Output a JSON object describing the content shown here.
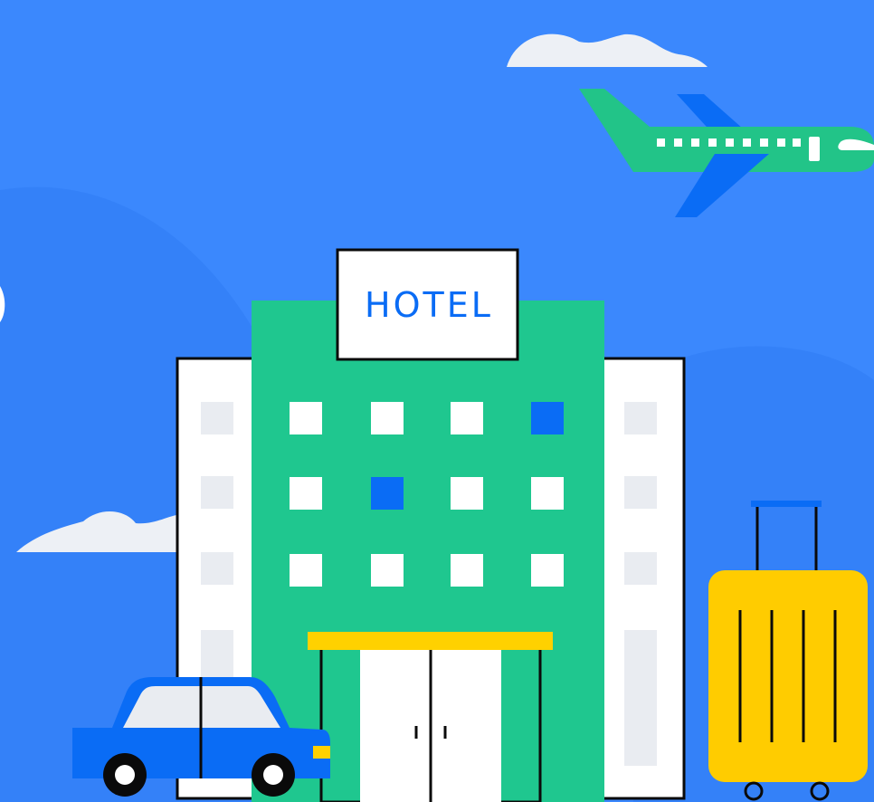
{
  "hotel_sign": {
    "text": "HOTEL"
  },
  "colors": {
    "sky": "#3b88fd",
    "sky_hill": "#3481f8",
    "cloud": "#edf0f5",
    "hotel_green": "#1fc78f",
    "hotel_side": "#ffffff",
    "window_gray": "#e9ecf1",
    "accent_blue": "#0a6cf5",
    "canopy_yellow": "#ffd100",
    "suitcase_yellow": "#ffcc00",
    "car_blue": "#0a6cf5",
    "car_window": "#e9ecf1",
    "outline": "#0a0a0a",
    "plane_green": "#22c488",
    "plane_wing": "#0a6cf5"
  },
  "icons": {
    "airplane": "airplane-icon",
    "car": "car-icon",
    "suitcase": "suitcase-icon",
    "hotel": "hotel-building-icon",
    "cloud": "cloud-icon"
  }
}
